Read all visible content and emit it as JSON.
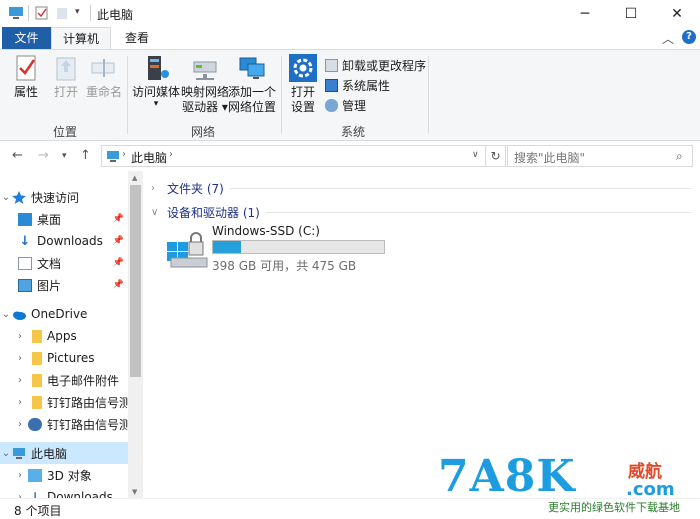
{
  "window": {
    "title": "此电脑",
    "controls": {
      "minimize": "─",
      "maximize": "☐",
      "close": "✕"
    }
  },
  "tabs": [
    {
      "label": "文件"
    },
    {
      "label": "计算机"
    },
    {
      "label": "查看"
    }
  ],
  "ribbon": {
    "location_group": {
      "label": "位置",
      "buttons": [
        {
          "label": "属性",
          "icon": "properties-icon"
        },
        {
          "label": "打开",
          "icon": "open-icon"
        },
        {
          "label": "重命名",
          "icon": "rename-icon"
        }
      ]
    },
    "network_group": {
      "label": "网络",
      "buttons": [
        {
          "line1": "访问媒体",
          "line2": "▾",
          "icon": "media-server-icon"
        },
        {
          "line1": "映射网络",
          "line2": "驱动器 ▾",
          "icon": "map-drive-icon"
        },
        {
          "line1": "添加一个",
          "line2": "网络位置",
          "icon": "network-location-icon"
        }
      ]
    },
    "system_group": {
      "label": "系统",
      "open_settings": {
        "line1": "打开",
        "line2": "设置",
        "icon": "settings-gear-icon"
      },
      "small_buttons": [
        {
          "label": "卸载或更改程序",
          "icon": "uninstall-icon"
        },
        {
          "label": "系统属性",
          "icon": "system-properties-icon"
        },
        {
          "label": "管理",
          "icon": "manage-icon"
        }
      ]
    }
  },
  "address": {
    "breadcrumb_root": "此电脑",
    "search_placeholder": "搜索\"此电脑\""
  },
  "sidebar": {
    "items": [
      {
        "label": "快速访问",
        "icon": "star-icon"
      },
      {
        "label": "桌面",
        "icon": "desktop-icon"
      },
      {
        "label": "Downloads",
        "icon": "download-icon"
      },
      {
        "label": "文档",
        "icon": "document-icon"
      },
      {
        "label": "图片",
        "icon": "pictures-icon"
      },
      {
        "label": "OneDrive",
        "icon": "cloud-icon"
      },
      {
        "label": "Apps",
        "icon": "folder-icon"
      },
      {
        "label": "Pictures",
        "icon": "folder-icon"
      },
      {
        "label": "电子邮件附件",
        "icon": "folder-icon"
      },
      {
        "label": "钉钉路由信号测试",
        "icon": "folder-icon"
      },
      {
        "label": "钉钉路由信号测试",
        "icon": "shared-folder-icon"
      },
      {
        "label": "此电脑",
        "icon": "computer-icon"
      },
      {
        "label": "3D 对象",
        "icon": "cube-icon"
      },
      {
        "label": "Downloads",
        "icon": "download-icon"
      }
    ]
  },
  "content": {
    "folders_header": "文件夹 (7)",
    "devices_header": "设备和驱动器 (1)",
    "drive": {
      "name": "Windows-SSD (C:)",
      "free_text": "398 GB 可用，共 475 GB",
      "used_fraction": 0.162
    }
  },
  "status": {
    "item_count": "8 个项目"
  },
  "watermark": {
    "logo": "7A8K",
    "domain": ".com",
    "brand_cn": "威航",
    "slogan": "更实用的绿色软件下载基地"
  },
  "colors": {
    "accent": "#1e5fa7",
    "selection": "#cce8ff",
    "drive_fill": "#26a0da",
    "section_header": "#1e3287"
  }
}
